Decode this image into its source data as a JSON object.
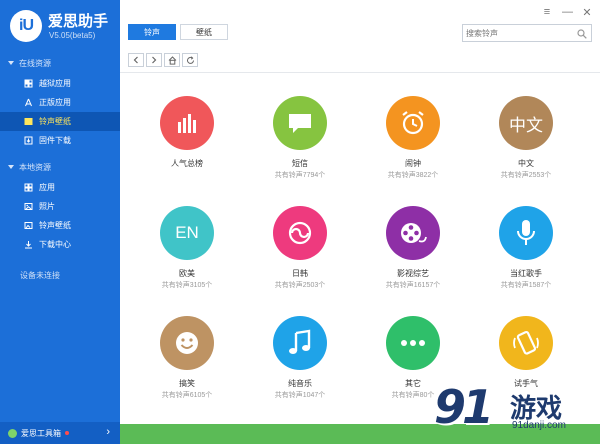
{
  "app": {
    "name": "爱思助手",
    "version": "V5.05(beta5)",
    "logo_text": "iU"
  },
  "sidebar": {
    "online_group": "在线资源",
    "online_items": [
      {
        "label": "越狱应用",
        "icon": "jailbreak-app-icon"
      },
      {
        "label": "正版应用",
        "icon": "appstore-icon"
      },
      {
        "label": "铃声壁纸",
        "icon": "ringtone-wallpaper-icon",
        "active": true
      },
      {
        "label": "固件下载",
        "icon": "firmware-download-icon"
      }
    ],
    "local_group": "本地资源",
    "local_items": [
      {
        "label": "应用",
        "icon": "apps-icon"
      },
      {
        "label": "照片",
        "icon": "photos-icon"
      },
      {
        "label": "铃声壁纸",
        "icon": "ringtone-wallpaper-icon"
      },
      {
        "label": "下载中心",
        "icon": "download-center-icon"
      }
    ],
    "device_status": "设备未连接",
    "footer_label": "爱思工具箱"
  },
  "toolbar": {
    "tab_ringtone": "铃声",
    "tab_wallpaper": "壁纸",
    "search_placeholder": "搜索铃声"
  },
  "categories": [
    {
      "name": "人气总榜",
      "count": "",
      "color": "#f0575a",
      "icon": "bar-chart-icon"
    },
    {
      "name": "短信",
      "count": "共有铃声7794个",
      "color": "#86c440",
      "icon": "sms-bubble-icon"
    },
    {
      "name": "闹钟",
      "count": "共有铃声3822个",
      "color": "#f49420",
      "icon": "alarm-clock-icon"
    },
    {
      "name": "中文",
      "count": "共有铃声2553个",
      "color": "#b18759",
      "icon": "chinese-text-icon",
      "text": "中文"
    },
    {
      "name": "欧美",
      "count": "共有铃声3105个",
      "color": "#40c4c8",
      "icon": "english-text-icon",
      "text": "EN"
    },
    {
      "name": "日韩",
      "count": "共有铃声2503个",
      "color": "#ee3a7e",
      "icon": "taiji-icon"
    },
    {
      "name": "影视综艺",
      "count": "共有铃声16157个",
      "color": "#8e2fa6",
      "icon": "film-reel-icon"
    },
    {
      "name": "当红歌手",
      "count": "共有铃声1587个",
      "color": "#1fa3e8",
      "icon": "microphone-icon"
    },
    {
      "name": "搞笑",
      "count": "共有铃声6105个",
      "color": "#be9363",
      "icon": "smiley-icon"
    },
    {
      "name": "纯音乐",
      "count": "共有铃声1047个",
      "color": "#1fa3e8",
      "icon": "music-note-icon"
    },
    {
      "name": "其它",
      "count": "共有铃声80个",
      "color": "#2fbf6a",
      "icon": "more-dots-icon"
    },
    {
      "name": "试手气",
      "count": "",
      "color": "#f1b61c",
      "icon": "shake-phone-icon"
    }
  ],
  "watermark": {
    "number": "91",
    "text": "游戏",
    "url": "91danji.com"
  }
}
